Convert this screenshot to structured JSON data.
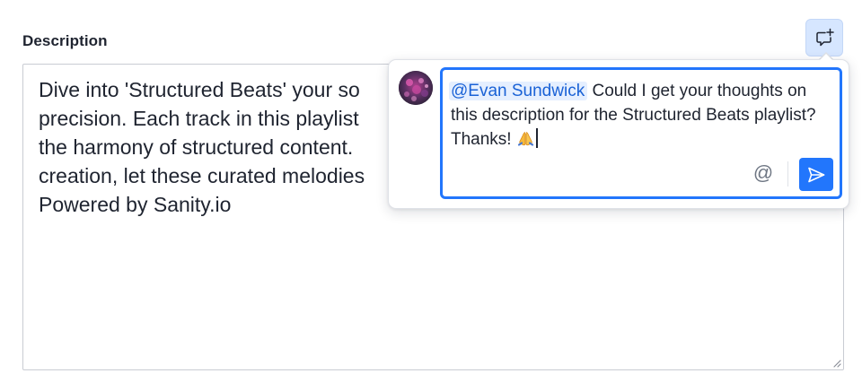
{
  "field": {
    "label": "Description",
    "value": "Dive into 'Structured Beats' your so\nprecision. Each track in this playlist\nthe harmony of structured content.\ncreation, let these curated melodies\nPowered by Sanity.io"
  },
  "comment_trigger": {
    "icon": "add-comment-icon",
    "active": true
  },
  "comment_popover": {
    "avatar_icon": "user-avatar",
    "composer": {
      "mention": "@Evan Sundwick",
      "text": " Could I get your thoughts on this description for the Structured Beats playlist? Thanks! ",
      "emoji": "🙏",
      "mention_button_label": "@",
      "send_icon": "send-icon"
    }
  },
  "colors": {
    "accent": "#2276fc",
    "mention_bg": "#e5efff",
    "mention_text": "#1a62d6",
    "trigger_bg": "#d6e6ff",
    "text": "#1f2430",
    "border": "#c9ccd3"
  }
}
